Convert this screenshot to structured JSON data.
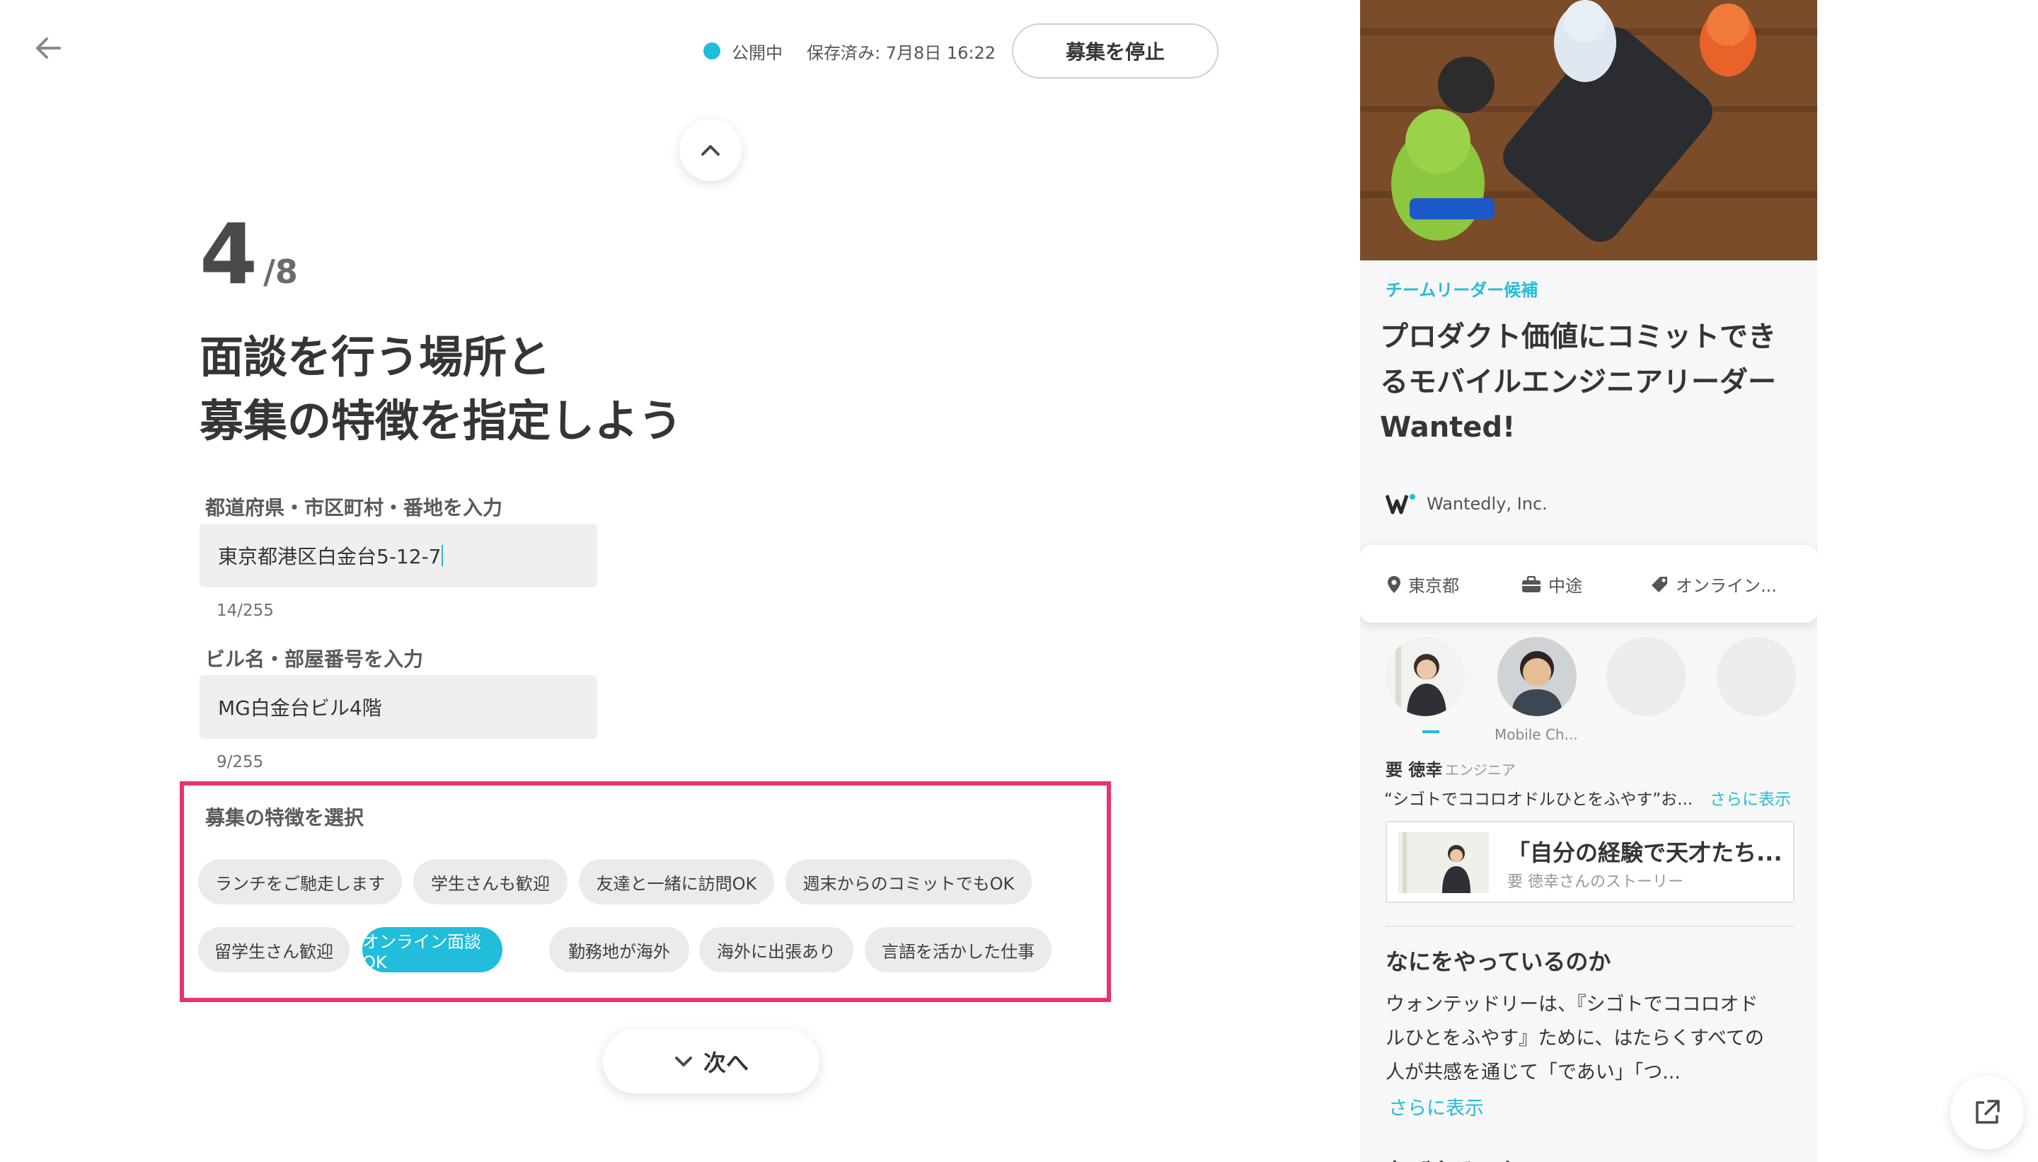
{
  "header": {
    "status_label": "公開中",
    "saved_text": "保存済み: 7月8日 16:22",
    "stop_button": "募集を停止",
    "status_color": "#21bddb"
  },
  "form": {
    "step_current": "4",
    "step_total": "/8",
    "title_line1": "面談を行う場所と",
    "title_line2": "募集の特徴を指定しよう",
    "address_label": "都道府県・市区町村・番地を入力",
    "address_value": "東京都港区白金台5-12-7",
    "address_counter": "14/255",
    "building_label": "ビル名・部屋番号を入力",
    "building_value": "MG白金台ビル4階",
    "building_counter": "9/255",
    "features_label": "募集の特徴を選択",
    "features": [
      {
        "label": "ランチをご馳走します",
        "selected": false
      },
      {
        "label": "学生さんも歓迎",
        "selected": false
      },
      {
        "label": "友達と一緒に訪問OK",
        "selected": false
      },
      {
        "label": "週末からのコミットでもOK",
        "selected": false
      },
      {
        "label": "留学生さん歓迎",
        "selected": false
      },
      {
        "label": "オンライン面談OK",
        "selected": true
      },
      {
        "label": "勤務地が海外",
        "selected": false
      },
      {
        "label": "海外に出張あり",
        "selected": false
      },
      {
        "label": "言語を活かした仕事",
        "selected": false
      }
    ],
    "next_button": "次へ",
    "highlight_color": "#e8336d"
  },
  "preview": {
    "tagline": "チームリーダー候補",
    "title_line1": "プロダクト価値にコミットでき",
    "title_line2": "るモバイルエンジニアリーダー",
    "title_line3": "Wanted!",
    "company": "Wantedly, Inc.",
    "info_location": "東京都",
    "info_type": "中途",
    "info_tag": "オンライン...",
    "member_caption": "Mobile Ch...",
    "member_name": "要 徳幸",
    "member_role": "エンジニア",
    "member_quote": "“シゴトでココロオドルひとをふやす”お...",
    "member_more": "さらに表示",
    "story_title": "「自分の経験で天才たち...",
    "story_sub": "要 徳幸さんのストーリー",
    "section_heading": "なにをやっているのか",
    "section_line1": "ウォンテッドリーは、『シゴトでココロオド",
    "section_line2": "ルひとをふやす』ために、はたらくすべての",
    "section_line3": "人が共感を通じて「であい」「つ...",
    "section_more": "さらに表示",
    "section_heading_2": "なぜやるのか"
  }
}
